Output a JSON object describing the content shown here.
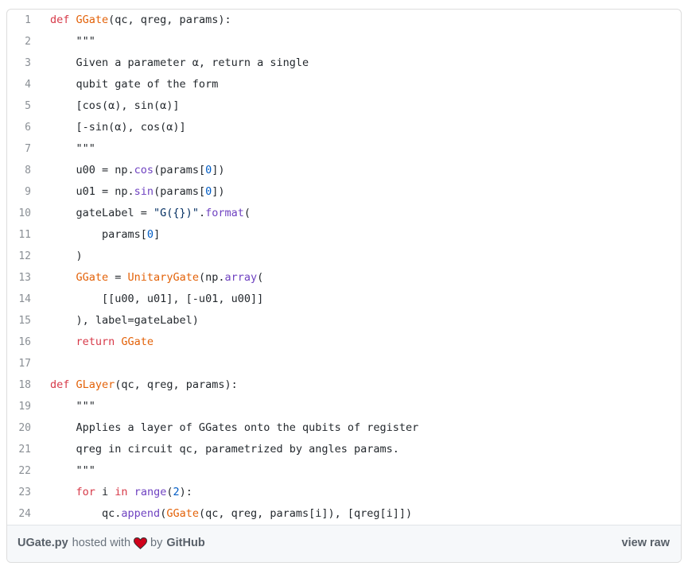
{
  "code": {
    "lines": [
      {
        "n": "1",
        "t": [
          [
            "k",
            "def "
          ],
          [
            "f",
            "GGate"
          ],
          [
            "",
            "(qc, qreg, params):"
          ]
        ]
      },
      {
        "n": "2",
        "t": [
          [
            "",
            "    \"\"\""
          ]
        ]
      },
      {
        "n": "3",
        "t": [
          [
            "",
            "    Given a parameter α, return a single"
          ]
        ]
      },
      {
        "n": "4",
        "t": [
          [
            "",
            "    qubit gate of the form"
          ]
        ]
      },
      {
        "n": "5",
        "t": [
          [
            "",
            "    [cos(α), sin(α)]"
          ]
        ]
      },
      {
        "n": "6",
        "t": [
          [
            "",
            "    [-sin(α), cos(α)]"
          ]
        ]
      },
      {
        "n": "7",
        "t": [
          [
            "",
            "    \"\"\""
          ]
        ]
      },
      {
        "n": "8",
        "t": [
          [
            "",
            "    u00 = np."
          ],
          [
            "b",
            "cos"
          ],
          [
            "",
            "(params["
          ],
          [
            "n",
            "0"
          ],
          [
            "",
            "])"
          ]
        ]
      },
      {
        "n": "9",
        "t": [
          [
            "",
            "    u01 = np."
          ],
          [
            "b",
            "sin"
          ],
          [
            "",
            "(params["
          ],
          [
            "n",
            "0"
          ],
          [
            "",
            "])"
          ]
        ]
      },
      {
        "n": "10",
        "t": [
          [
            "",
            "    gateLabel = "
          ],
          [
            "s",
            "\"G({})\""
          ],
          [
            "",
            "."
          ],
          [
            "b",
            "format"
          ],
          [
            "",
            "("
          ]
        ]
      },
      {
        "n": "11",
        "t": [
          [
            "",
            "        params["
          ],
          [
            "n",
            "0"
          ],
          [
            "",
            "]"
          ]
        ]
      },
      {
        "n": "12",
        "t": [
          [
            "",
            "    )"
          ]
        ]
      },
      {
        "n": "13",
        "t": [
          [
            "",
            "    "
          ],
          [
            "f",
            "GGate"
          ],
          [
            "",
            " = "
          ],
          [
            "f",
            "UnitaryGate"
          ],
          [
            "",
            "(np."
          ],
          [
            "b",
            "array"
          ],
          [
            "",
            "("
          ]
        ]
      },
      {
        "n": "14",
        "t": [
          [
            "",
            "        [[u00, u01], [-u01, u00]]"
          ]
        ]
      },
      {
        "n": "15",
        "t": [
          [
            "",
            "    ), label=gateLabel)"
          ]
        ]
      },
      {
        "n": "16",
        "t": [
          [
            "",
            "    "
          ],
          [
            "k",
            "return "
          ],
          [
            "f",
            "GGate"
          ]
        ]
      },
      {
        "n": "17",
        "t": [
          [
            "",
            ""
          ]
        ]
      },
      {
        "n": "18",
        "t": [
          [
            "k",
            "def "
          ],
          [
            "f",
            "GLayer"
          ],
          [
            "",
            "(qc, qreg, params):"
          ]
        ]
      },
      {
        "n": "19",
        "t": [
          [
            "",
            "    \"\"\""
          ]
        ]
      },
      {
        "n": "20",
        "t": [
          [
            "",
            "    Applies a layer of GGates onto the qubits of register"
          ]
        ]
      },
      {
        "n": "21",
        "t": [
          [
            "",
            "    qreg in circuit qc, parametrized by angles params."
          ]
        ]
      },
      {
        "n": "22",
        "t": [
          [
            "",
            "    \"\"\""
          ]
        ]
      },
      {
        "n": "23",
        "t": [
          [
            "",
            "    "
          ],
          [
            "k",
            "for"
          ],
          [
            "",
            " i "
          ],
          [
            "k",
            "in "
          ],
          [
            "b",
            "range"
          ],
          [
            "",
            "("
          ],
          [
            "n",
            "2"
          ],
          [
            "",
            "):"
          ]
        ]
      },
      {
        "n": "24",
        "t": [
          [
            "",
            "        qc."
          ],
          [
            "b",
            "append"
          ],
          [
            "",
            "("
          ],
          [
            "f",
            "GGate"
          ],
          [
            "",
            "(qc, qreg, params[i]), [qreg[i]])"
          ]
        ]
      }
    ]
  },
  "footer": {
    "filename": "UGate.py",
    "hosted_with": "hosted with",
    "heart_icon": "heart-icon",
    "by": "by",
    "github": "GitHub",
    "view_raw": "view raw",
    "heart_color": "#d0021b"
  }
}
